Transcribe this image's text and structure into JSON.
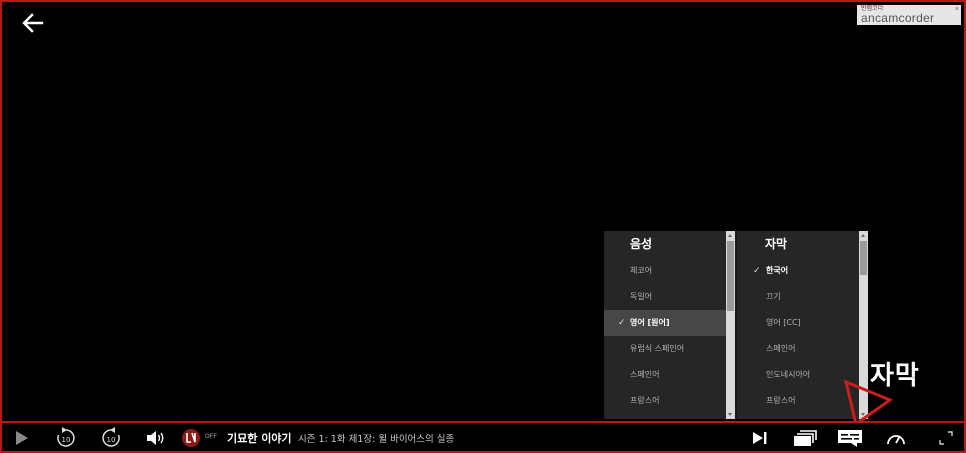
{
  "watermark": {
    "small": "반캠코더",
    "big": "ancamcorder",
    "close": "×"
  },
  "audio_menu": {
    "header": "음성",
    "items": [
      {
        "label": "체코어",
        "selected": false
      },
      {
        "label": "독일어",
        "selected": false
      },
      {
        "label": "영어 [원어]",
        "selected": true
      },
      {
        "label": "유럽식 스페인어",
        "selected": false
      },
      {
        "label": "스페인어",
        "selected": false
      },
      {
        "label": "프랑스어",
        "selected": false
      }
    ]
  },
  "subtitle_menu": {
    "header": "자막",
    "items": [
      {
        "label": "한국어",
        "selected": true
      },
      {
        "label": "끄기",
        "selected": false
      },
      {
        "label": "영어 [CC]",
        "selected": false
      },
      {
        "label": "스페인어",
        "selected": false
      },
      {
        "label": "인도네시아어",
        "selected": false
      },
      {
        "label": "프랑스어",
        "selected": false
      }
    ]
  },
  "check_glyph": "✓",
  "annotation": {
    "label": "자막"
  },
  "player": {
    "show_title": "기묘한 이야기",
    "episode_info": "시즌 1: 1화  제1장: 윌 바이어스의 실종",
    "skip_seconds": "10",
    "auto_badge_state": "OFF"
  },
  "colors": {
    "accent_red": "#b41a1a",
    "menu_bg": "#262626",
    "selected_row": "#474747"
  },
  "icons": {
    "back": "arrow-left-icon",
    "play": "play-icon",
    "rewind": "rewind-10-icon",
    "forward": "forward-10-icon",
    "volume": "volume-icon",
    "next": "next-episode-icon",
    "episodes": "episodes-icon",
    "subtitles": "subtitles-icon",
    "speed": "speed-icon",
    "fullscreen": "fullscreen-icon"
  }
}
